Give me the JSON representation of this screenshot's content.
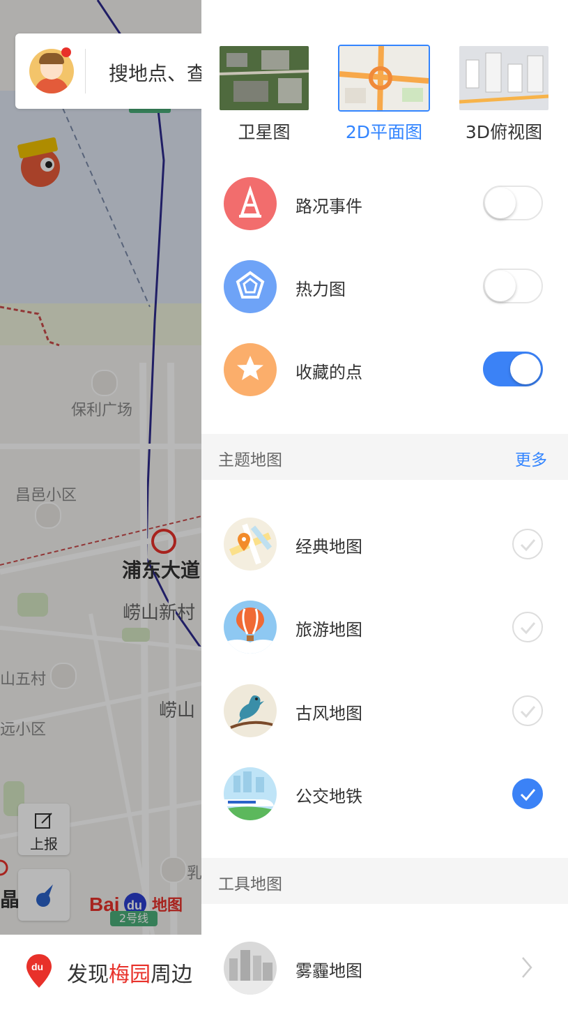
{
  "search": {
    "placeholder": "搜地点、查"
  },
  "map": {
    "labels": [
      "保利广场",
      "昌邑小区",
      "浦东大道",
      "崂山新村",
      "山五村",
      "远小区",
      "崂山",
      "乳",
      "晶路"
    ],
    "report_label": "上报",
    "metro_line": "2号线",
    "logo_text": "地图"
  },
  "bottom": {
    "prefix": "发现",
    "highlight": "梅园",
    "suffix": "周边"
  },
  "panel": {
    "modes": [
      {
        "label": "卫星图",
        "active": false
      },
      {
        "label": "2D平面图",
        "active": true
      },
      {
        "label": "3D俯视图",
        "active": false
      }
    ],
    "layers": [
      {
        "label": "路况事件",
        "icon": "traffic-cone-icon",
        "color": "#f26d6d",
        "on": false
      },
      {
        "label": "热力图",
        "icon": "pentagon-icon",
        "color": "#6ea3f7",
        "on": false
      },
      {
        "label": "收藏的点",
        "icon": "star-icon",
        "color": "#fbae6b",
        "on": true
      }
    ],
    "theme_section": {
      "title": "主题地图",
      "more": "更多"
    },
    "themes": [
      {
        "label": "经典地图",
        "icon": "classic-map-icon",
        "checked": false
      },
      {
        "label": "旅游地图",
        "icon": "hot-air-balloon-icon",
        "checked": false
      },
      {
        "label": "古风地图",
        "icon": "bird-icon",
        "checked": false
      },
      {
        "label": "公交地铁",
        "icon": "train-icon",
        "checked": true
      }
    ],
    "tool_section": {
      "title": "工具地图"
    },
    "tools": [
      {
        "label": "雾霾地图",
        "icon": "smog-city-icon"
      }
    ]
  },
  "colors": {
    "accent": "#3385ff",
    "toggle_on": "#3b82f6"
  }
}
